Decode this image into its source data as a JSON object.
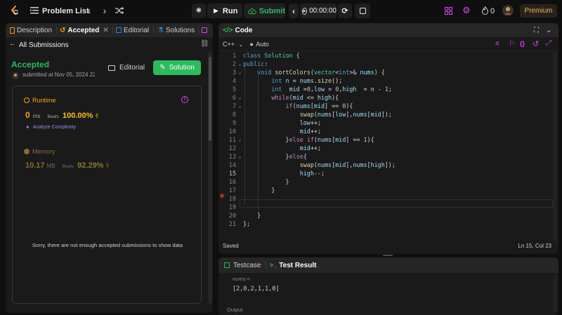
{
  "nav": {
    "problem_list": "Problem List",
    "run": "Run",
    "submit": "Submit",
    "timer": "00:00:00",
    "fire_count": "0",
    "premium": "Premium"
  },
  "left_tabs": {
    "description": "Description",
    "accepted": "Accepted",
    "editorial": "Editorial",
    "solutions": "Solutions"
  },
  "submission": {
    "back": "All Submissions",
    "status": "Accepted",
    "submitted": "submitted at Nov 05, 2024 22:",
    "editorial_btn": "Editorial",
    "solution_btn": "Solution"
  },
  "runtime": {
    "label": "Runtime",
    "value": "0",
    "unit": "ms",
    "beats_label": "Beats",
    "beats": "100.00%",
    "analyze": "Analyze Complexity"
  },
  "memory": {
    "label": "Memory",
    "value": "10.17",
    "unit": "MB",
    "beats_label": "Beats",
    "beats": "92.29%"
  },
  "empty_msg": "Sorry, there are not enough accepted submissions to show data",
  "code": {
    "tab": "Code",
    "language": "C++",
    "mode": "Auto",
    "status": "Saved",
    "cursor": "Ln 15, Col 23",
    "lines": [
      "class Solution {",
      "public:",
      "    void sortColors(vector<int>& nums) {",
      "        int n = nums.size();",
      "        int  mid =0,low = 0,high  = n - 1;",
      "        while(mid <= high){",
      "            if(nums[mid] == 0){",
      "                swap(nums[low],nums[mid]);",
      "                low++;",
      "                mid++;",
      "            }else if(nums[mid] == 1){",
      "                mid++;",
      "            }else{",
      "                swap(nums[mid],nums[high]);",
      "                high--;",
      "            }",
      "        }",
      "",
      "",
      "    }",
      "};"
    ]
  },
  "test": {
    "testcase_tab": "Testcase",
    "result_tab": "Test Result",
    "input_label": "nums =",
    "input_value": "[2,0,2,1,1,0]",
    "output_label": "Output"
  },
  "colors": {
    "accent_green": "#2cbb5d",
    "accent_orange": "#ffa116",
    "accent_pink": "#e040fb",
    "background": "#0f0f0f",
    "panel": "#1a1a1a"
  }
}
